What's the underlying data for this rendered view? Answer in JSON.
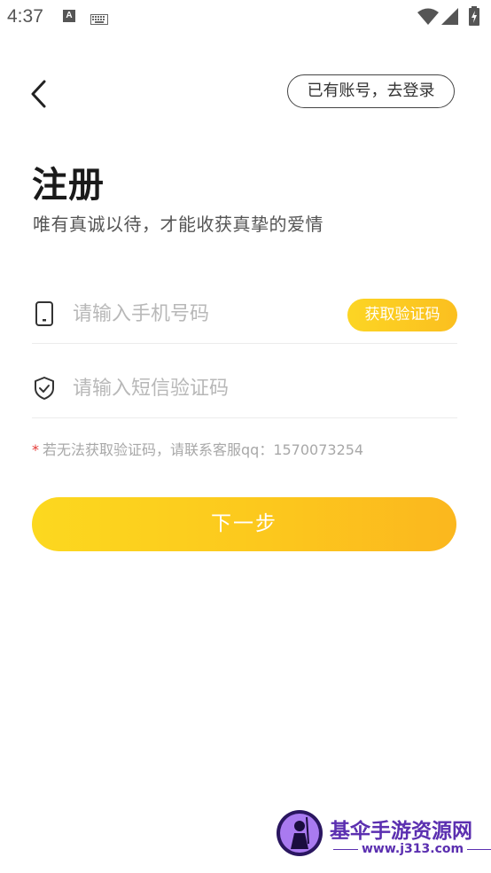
{
  "status_bar": {
    "time": "4:37",
    "a_badge": "A",
    "icons": [
      "a-notification-icon",
      "keyboard-icon",
      "wifi-icon",
      "signal-icon",
      "battery-charging-icon"
    ]
  },
  "header": {
    "back_icon": "chevron-left-icon",
    "login_link": "已有账号，去登录"
  },
  "title": "注册",
  "subtitle": "唯有真诚以待，才能收获真挚的爱情",
  "phone_field": {
    "icon": "phone-icon",
    "placeholder": "请输入手机号码",
    "value": "",
    "get_code_label": "获取验证码"
  },
  "code_field": {
    "icon": "shield-check-icon",
    "placeholder": "请输入短信验证码",
    "value": ""
  },
  "hint": {
    "star": "*",
    "text": "若无法获取验证码，请联系客服qq：1570073254"
  },
  "next_button": "下一步",
  "watermark": {
    "title": "基伞手游资源网",
    "url": "www.j313.com"
  },
  "colors": {
    "accent_start": "#fcd81f",
    "accent_end": "#fbb71e",
    "hint_star": "#e53935",
    "watermark": "#5b2fb0"
  }
}
